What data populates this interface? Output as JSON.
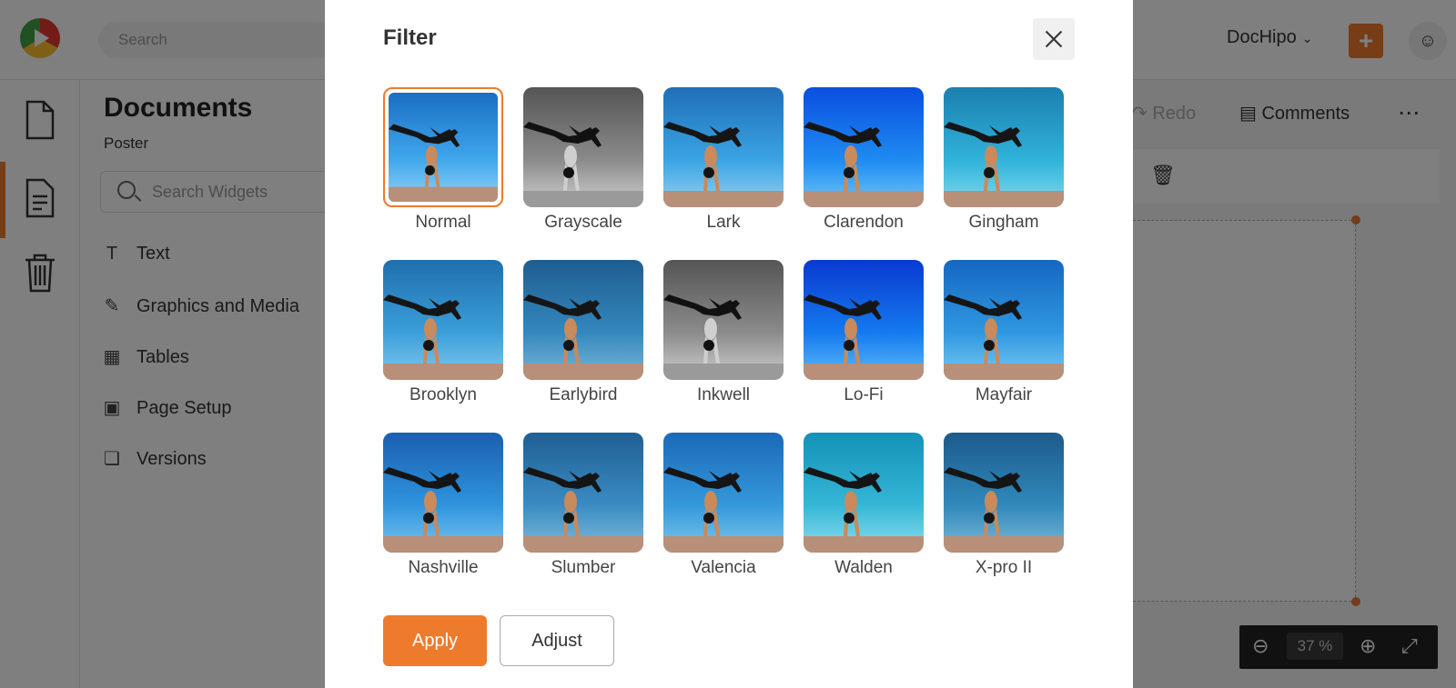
{
  "topbar": {
    "search_placeholder": "Search",
    "brand_menu": "DocHipo",
    "plus_label": "+"
  },
  "panel": {
    "title": "Documents",
    "subtitle": "Poster",
    "search_placeholder": "Search Widgets",
    "items": [
      {
        "label": "Text",
        "icon": "text-icon"
      },
      {
        "label": "Graphics and Media",
        "icon": "graphics-icon"
      },
      {
        "label": "Tables",
        "icon": "table-icon"
      },
      {
        "label": "Page Setup",
        "icon": "page-setup-icon"
      },
      {
        "label": "Versions",
        "icon": "versions-icon"
      }
    ]
  },
  "editor": {
    "redo_label": "Redo",
    "comments_label": "Comments",
    "zoom_value": "37",
    "zoom_unit": "%"
  },
  "modal": {
    "title": "Filter",
    "apply_label": "Apply",
    "adjust_label": "Adjust",
    "filters": [
      {
        "label": "Normal",
        "selected": true,
        "style": "normal"
      },
      {
        "label": "Grayscale",
        "selected": false,
        "style": "gray"
      },
      {
        "label": "Lark",
        "selected": false,
        "style": "lark"
      },
      {
        "label": "Clarendon",
        "selected": false,
        "style": "clarendon"
      },
      {
        "label": "Gingham",
        "selected": false,
        "style": "gingham"
      },
      {
        "label": "Brooklyn",
        "selected": false,
        "style": "brooklyn"
      },
      {
        "label": "Earlybird",
        "selected": false,
        "style": "earlybird"
      },
      {
        "label": "Inkwell",
        "selected": false,
        "style": "gray"
      },
      {
        "label": "Lo-Fi",
        "selected": false,
        "style": "lofi"
      },
      {
        "label": "Mayfair",
        "selected": false,
        "style": "mayfair"
      },
      {
        "label": "Nashville",
        "selected": false,
        "style": "nashville"
      },
      {
        "label": "Slumber",
        "selected": false,
        "style": "slumber"
      },
      {
        "label": "Valencia",
        "selected": false,
        "style": "valencia"
      },
      {
        "label": "Walden",
        "selected": false,
        "style": "walden"
      },
      {
        "label": "X-pro II",
        "selected": false,
        "style": "xpro"
      }
    ]
  },
  "colors": {
    "accent": "#ee7a2c"
  }
}
